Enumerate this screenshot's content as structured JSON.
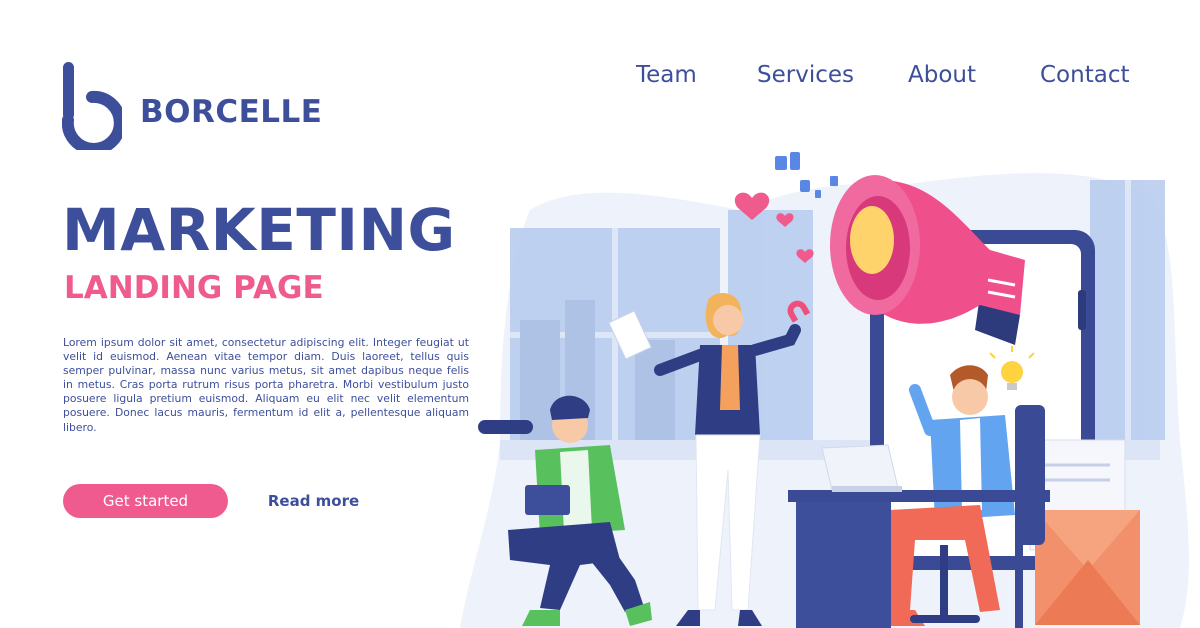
{
  "brand": {
    "name": "BORCELLE",
    "logo_icon": "b-logo-icon",
    "color": "#3d4f9b"
  },
  "nav": {
    "items": [
      "Team",
      "Services",
      "About",
      "Contact"
    ]
  },
  "hero": {
    "title": "MARKETING",
    "subtitle": "LANDING PAGE",
    "body": "Lorem ipsum dolor sit amet, consectetur adipiscing elit. Integer feugiat ut velit id euismod. Aenean vitae tempor diam. Duis laoreet, tellus quis semper pulvinar, massa nunc varius metus, sit amet dapibus neque felis in metus. Cras porta rutrum risus porta pharetra. Morbi vestibulum justo posuere ligula pretium euismod. Aliquam eu elit nec velit elementum posuere. Donec lacus mauris, fermentum id elit a, pellentesque aliquam libero.",
    "primary_button": "Get started",
    "secondary_button": "Read more"
  },
  "colors": {
    "primary": "#3d4f9b",
    "accent": "#ef5b8e",
    "background": "#ffffff"
  },
  "illustration": {
    "icons": [
      "megaphone-icon",
      "thumbs-up-icon",
      "heart-icon",
      "lightbulb-icon",
      "binoculars-icon",
      "magnet-icon",
      "laptop-icon",
      "smartphone-icon",
      "document-icon",
      "envelope-icon"
    ]
  }
}
